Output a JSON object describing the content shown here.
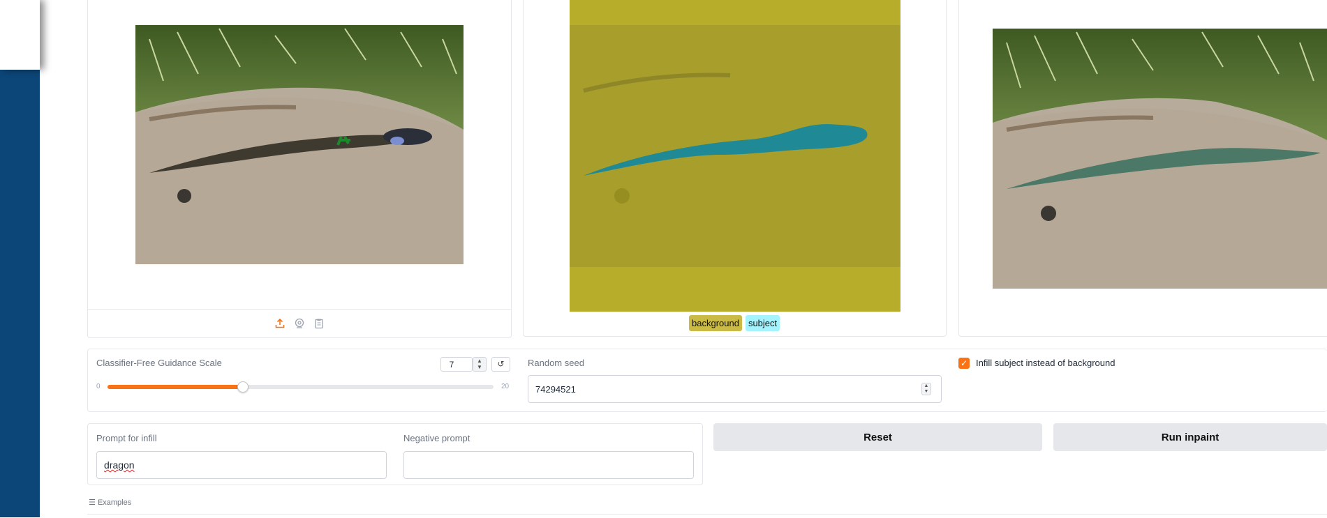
{
  "legend": {
    "background": "background",
    "subject": "subject"
  },
  "cfg": {
    "label": "Classifier-Free Guidance Scale",
    "value": "7",
    "min_label": "0",
    "max_label": "20",
    "level": 0.35,
    "reset_icon": "↺"
  },
  "seed": {
    "label": "Random seed",
    "value": "74294521"
  },
  "infill": {
    "label": "Infill subject instead of background",
    "checked": true
  },
  "prompt": {
    "label": "Prompt for infill",
    "value": "dragon"
  },
  "negative": {
    "label": "Negative prompt",
    "value": ""
  },
  "buttons": {
    "reset": "Reset",
    "run": "Run inpaint"
  },
  "examples": {
    "label": "Examples"
  },
  "icons": {
    "upload": "upload-icon",
    "webcam": "webcam-icon",
    "clipboard": "clipboard-icon",
    "collapse": "list-icon"
  },
  "colors": {
    "accent": "#f97316",
    "mask_background": "#b8ad2a",
    "mask_subject": "#1f8a95",
    "legend_background": "#c9bb46",
    "legend_subject": "#a5f3fc",
    "sidebar": "#0c4577"
  }
}
